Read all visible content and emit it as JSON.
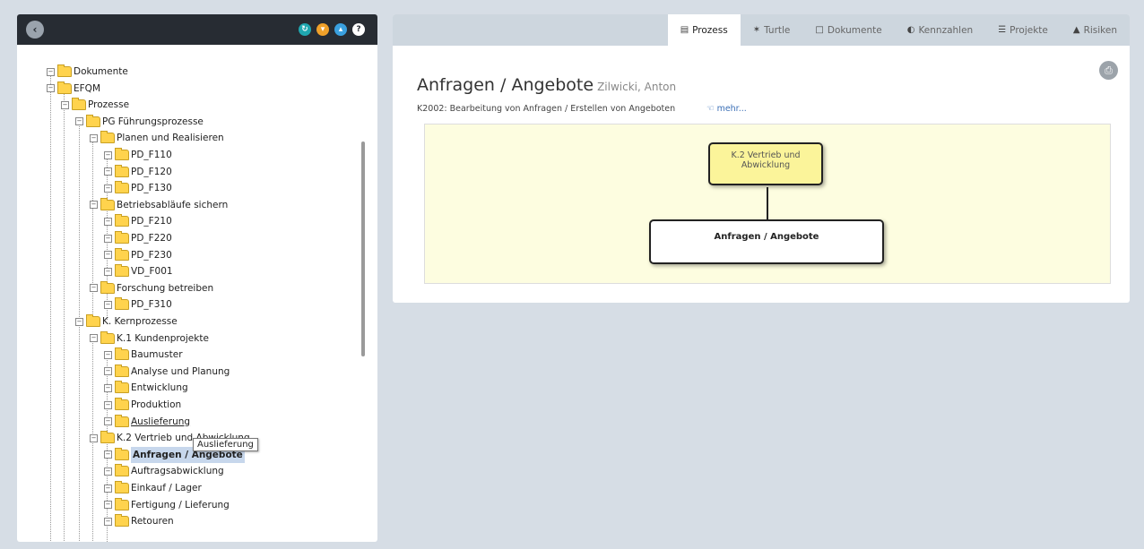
{
  "header_icons": {
    "colors": [
      "#1fa7b0",
      "#f0a12a",
      "#3aa0df",
      "#ffffff"
    ]
  },
  "tree": {
    "items": [
      {
        "label": "Dokumente",
        "level": 0
      },
      {
        "label": "EFQM",
        "level": 0
      },
      {
        "label": "Prozesse",
        "level": 1
      },
      {
        "label": "PG Führungsprozesse",
        "level": 2
      },
      {
        "label": "Planen und Realisieren",
        "level": 3
      },
      {
        "label": "PD_F110",
        "level": 4
      },
      {
        "label": "PD_F120",
        "level": 4
      },
      {
        "label": "PD_F130",
        "level": 4
      },
      {
        "label": "Betriebsabläufe sichern",
        "level": 3
      },
      {
        "label": "PD_F210",
        "level": 4
      },
      {
        "label": "PD_F220",
        "level": 4
      },
      {
        "label": "PD_F230",
        "level": 4
      },
      {
        "label": "VD_F001",
        "level": 4
      },
      {
        "label": "Forschung betreiben",
        "level": 3
      },
      {
        "label": "PD_F310",
        "level": 4
      },
      {
        "label": "K. Kernprozesse",
        "level": 2
      },
      {
        "label": "K.1 Kundenprojekte",
        "level": 3
      },
      {
        "label": "Baumuster",
        "level": 4
      },
      {
        "label": "Analyse und Planung",
        "level": 4
      },
      {
        "label": "Entwicklung",
        "level": 4
      },
      {
        "label": "Produktion",
        "level": 4
      },
      {
        "label": "Auslieferung",
        "level": 4
      },
      {
        "label": "K.2 Vertrieb und Abwicklung",
        "level": 3
      },
      {
        "label": "Anfragen / Angebote",
        "level": 4
      },
      {
        "label": "Auftragsabwicklung",
        "level": 4
      },
      {
        "label": "Einkauf / Lager",
        "level": 4
      },
      {
        "label": "Fertigung / Lieferung",
        "level": 4
      },
      {
        "label": "Retouren",
        "level": 4
      }
    ],
    "tooltip": "Auslieferung"
  },
  "tabs": [
    {
      "label": "Prozess",
      "icon": "sitemap-icon"
    },
    {
      "label": "Turtle",
      "icon": "turtle-icon"
    },
    {
      "label": "Dokumente",
      "icon": "document-icon"
    },
    {
      "label": "Kennzahlen",
      "icon": "dashboard-icon"
    },
    {
      "label": "Projekte",
      "icon": "list-icon"
    },
    {
      "label": "Risiken",
      "icon": "warning-icon"
    }
  ],
  "main": {
    "title": "Anfragen / Angebote",
    "owner": "Zilwicki, Anton",
    "description": "K2002: Bearbeitung von Anfragen / Erstellen von Angeboten",
    "more": "mehr..."
  },
  "diagram": {
    "parent": "K.2 Vertrieb und Abwicklung",
    "child": "Anfragen / Angebote"
  }
}
